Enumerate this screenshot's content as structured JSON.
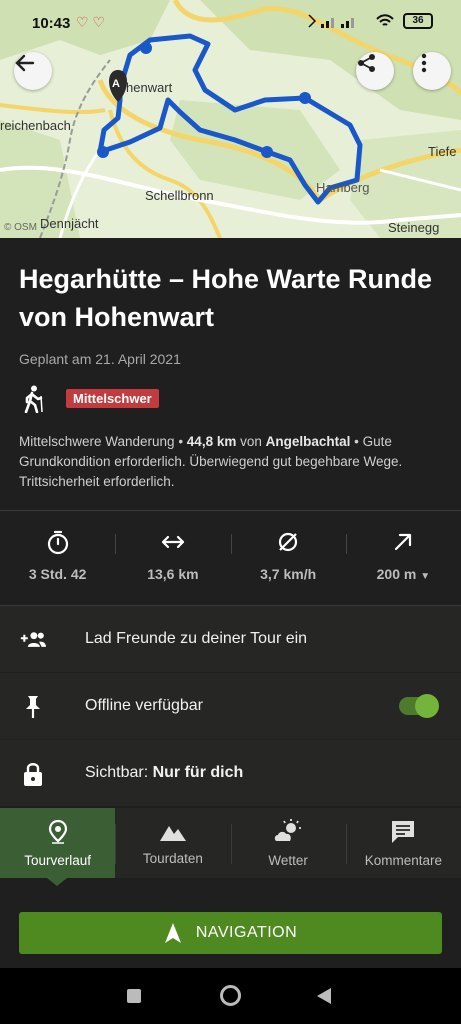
{
  "status": {
    "time": "10:43",
    "battery": "36"
  },
  "map": {
    "labels": {
      "hohenwart": "henwart",
      "marker": "A",
      "reichenbach": "reichenbach",
      "schellbronn": "Schellbronn",
      "dennjaecht": "Dennjächt",
      "steinegg": "Steinegg",
      "tiefe": "Tiefe",
      "hamberg": "Hamberg"
    },
    "credit": "© OSM",
    "route_color": "#1a58c9"
  },
  "tour": {
    "title": "Hegarhütte – Hohe Warte Runde von Hohenwart",
    "planned": "Geplant am 21. April 2021",
    "difficulty": "Mittelschwer",
    "difficulty_color": "#c23b3f",
    "desc_prefix": "Mittelschwere Wanderung • ",
    "desc_distance": "44,8 km",
    "desc_from": " von ",
    "desc_place": "Angelbachtal",
    "desc_rest": " • Gute Grundkondition erforderlich. Überwiegend gut begehbare Wege. Trittsicherheit erforderlich."
  },
  "stats": {
    "duration": "3 Std. 42",
    "distance": "13,6 km",
    "speed": "3,7 km/h",
    "elevation": "200 m"
  },
  "rows": {
    "invite": "Lad Freunde zu deiner Tour ein",
    "offline": "Offline verfügbar",
    "offline_enabled": true,
    "visibility_prefix": "Sichtbar: ",
    "visibility_value": "Nur für dich"
  },
  "tabs": {
    "route": "Tourverlauf",
    "data": "Tourdaten",
    "weather": "Wetter",
    "comments": "Kommentare"
  },
  "navigation": {
    "label": "NAVIGATION",
    "color": "#4e8a1f"
  }
}
